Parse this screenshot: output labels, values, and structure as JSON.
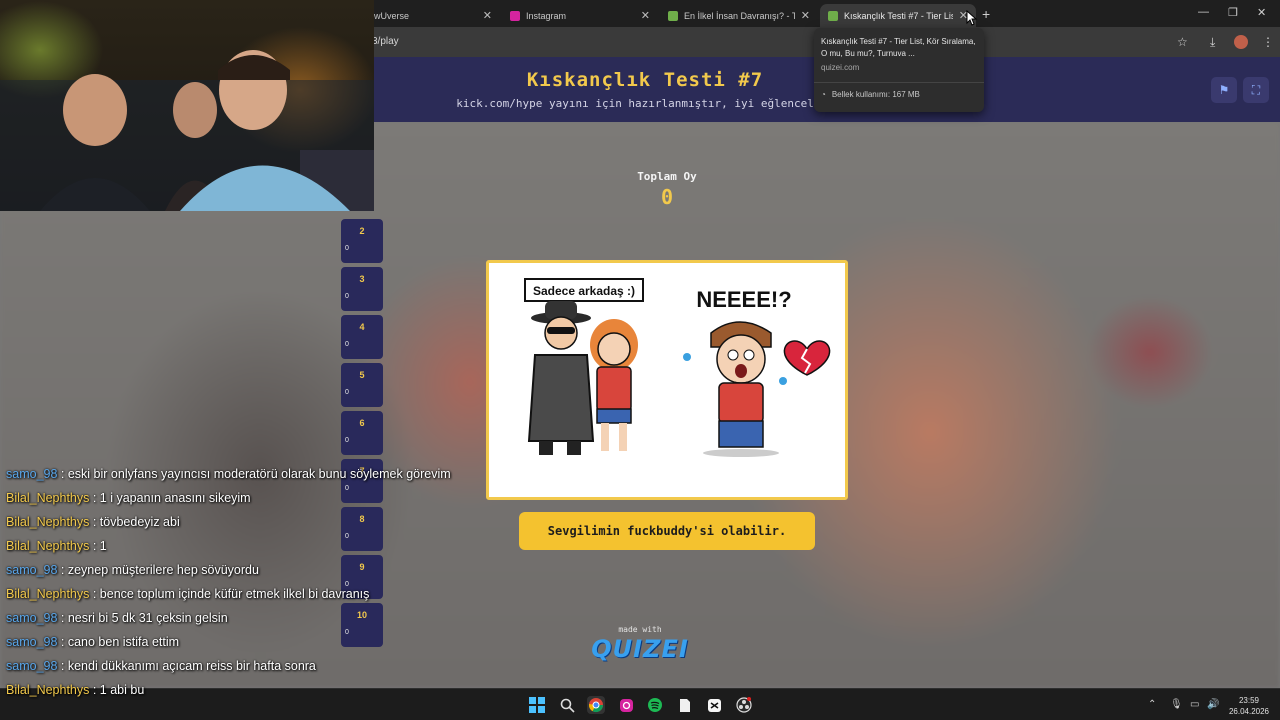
{
  "browser": {
    "tabs": [
      {
        "title": "wUverse",
        "favicon_color": "#3a3a3a"
      },
      {
        "title": "Instagram",
        "favicon_color": "#d6249f"
      },
      {
        "title": "En İlkel İnsan Davranışı? - Tier L",
        "favicon_color": "#6fae4a"
      },
      {
        "title": "Kıskançlık Testi #7 - Tier List, Kö",
        "favicon_color": "#6fae4a",
        "active": true
      }
    ],
    "url": "3/play",
    "tooltip": {
      "title": "Kıskançlık Testi #7 - Tier List, Kör Sıralama, O mu, Bu mu?, Turnuva ...",
      "host": "quizei.com",
      "memory": "Bellek kullanımı: 167 MB"
    }
  },
  "page": {
    "title": "Kıskançlık Testi #7",
    "subtitle": "kick.com/hype yayını için hazırlanmıştır, iyi eğlenceler!",
    "vote_label": "Toplam Oy",
    "vote_count": "0",
    "comic": {
      "sign_text": "Sadece arkadaş :)",
      "shout_text": "NEEEE!?"
    },
    "answer": "Sevgilimin fuckbuddy'si olabilir.",
    "made_with": "made with",
    "brand": "QUIZEI"
  },
  "tiers": [
    {
      "num": "2",
      "count": "0"
    },
    {
      "num": "3",
      "count": "0"
    },
    {
      "num": "4",
      "count": "0"
    },
    {
      "num": "5",
      "count": "0"
    },
    {
      "num": "6",
      "count": "0"
    },
    {
      "num": "7",
      "count": "0"
    },
    {
      "num": "8",
      "count": "0"
    },
    {
      "num": "9",
      "count": "0"
    },
    {
      "num": "10",
      "count": "0"
    }
  ],
  "chat": [
    {
      "user": "samo_98",
      "text": " : eski bir onlyfans yayıncısı moderatörü olarak bunu söylemek görevim",
      "color": "blue"
    },
    {
      "user": "Bilal_Nephthys",
      "text": " : 1 i yapanın anasını sikeyim",
      "color": "gold"
    },
    {
      "user": "Bilal_Nephthys",
      "text": " : tövbedeyiz abi",
      "color": "gold"
    },
    {
      "user": "Bilal_Nephthys",
      "text": " : 1",
      "color": "gold"
    },
    {
      "user": "samo_98",
      "text": " : zeynep müşterilere hep sövüyordu",
      "color": "blue"
    },
    {
      "user": "Bilal_Nephthys",
      "text": " : bence toplum içinde küfür etmek ilkel bi davranış",
      "color": "gold"
    },
    {
      "user": "samo_98",
      "text": " : nesri bi 5 dk 31 çeksin gelsin",
      "color": "blue"
    },
    {
      "user": "samo_98",
      "text": " : cano ben istifa ettim",
      "color": "blue"
    },
    {
      "user": "samo_98",
      "text": " : kendi dükkanımı açıcam reiss bir hafta sonra",
      "color": "blue"
    },
    {
      "user": "Bilal_Nephthys",
      "text": " : 1 abi bu",
      "color": "gold"
    }
  ],
  "taskbar": {
    "time": "23:59",
    "date": "26.04.2026"
  }
}
